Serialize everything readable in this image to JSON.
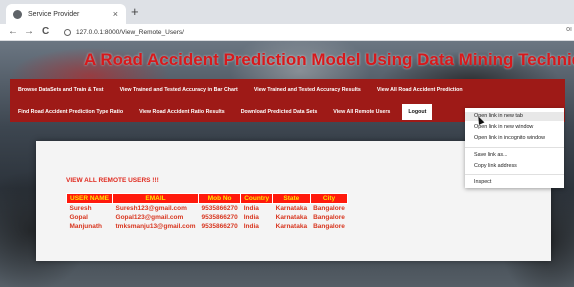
{
  "browser": {
    "tab_title": "Service Provider",
    "tab_close": "×",
    "new_tab": "+",
    "back": "←",
    "forward": "→",
    "reload": "C",
    "url": "127.0.0.1:8000/View_Remote_Users/",
    "menu_glyph": "oı"
  },
  "site": {
    "title": "A Road Accident Prediction Model Using Data Mining Techniques"
  },
  "nav": {
    "row1": [
      "Browse DataSets and Train & Test",
      "View Trained and Tested Accuracy in Bar Chart",
      "View Trained and Tested Accuracy Results",
      "View All Road Accident Prediction"
    ],
    "row2": [
      "Find Road Accident Prediction Type Ratio",
      "View Road Accident Ratio Results",
      "Download Predicted Data Sets",
      "View All Remote Users"
    ],
    "logout": "Logout"
  },
  "users": {
    "heading": "VIEW ALL REMOTE USERS !!!",
    "columns": [
      "USER NAME",
      "EMAIL",
      "Mob No",
      "Country",
      "State",
      "City"
    ],
    "rows": [
      [
        "Suresh",
        "Suresh123@gmail.com",
        "9535866270",
        "India",
        "Karnataka",
        "Bangalore"
      ],
      [
        "Gopal",
        "Gopal123@gmail.com",
        "9535866270",
        "India",
        "Karnataka",
        "Bangalore"
      ],
      [
        "Manjunath",
        "tmksmanju13@gmail.com",
        "9535866270",
        "India",
        "Karnataka",
        "Bangalore"
      ]
    ]
  },
  "context_menu": {
    "items": [
      "Open link in new tab",
      "Open link in new window",
      "Open link in incognito window",
      "Save link as...",
      "Copy link address",
      "Inspect"
    ]
  },
  "colors": {
    "nav_bg": "#9e1a17",
    "title_red": "#d7191c",
    "header_bg": "#ff1a0c",
    "header_text": "#ffe400",
    "cell_text": "#d8361f"
  }
}
